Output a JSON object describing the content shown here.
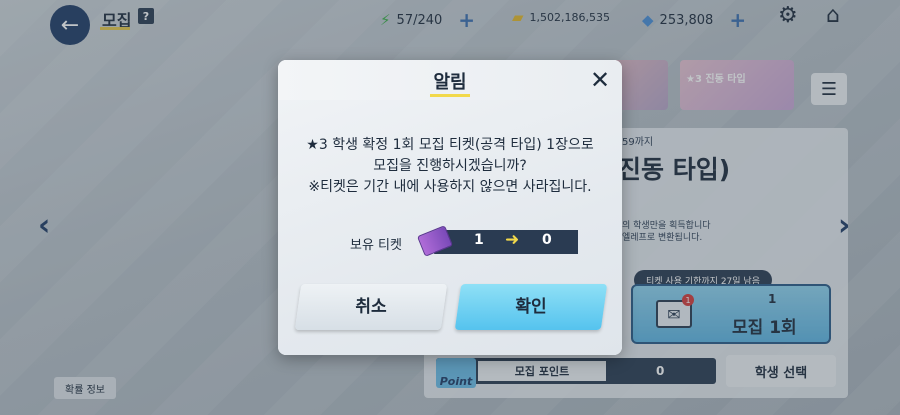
{
  "topbar": {
    "title": "모집",
    "help": "?",
    "ap": "57/240",
    "credits": "1,502,186,535",
    "gems": "253,808"
  },
  "background": {
    "banner_b_label": "★3 진동 타입",
    "panel_date": "59까지",
    "panel_title": "진동 타입)",
    "panel_desc1": "의 학생만을 획득합니다",
    "panel_desc2": "엘레프로 변환됩니다.",
    "ticket_expire": "티켓 사용 기한까지 27일 남음",
    "recruit_count": "1",
    "recruit_badge": "1",
    "recruit_label": "모집 1회",
    "point_icon": "Point",
    "point_label": "모집 포인트",
    "point_value": "0",
    "student_select": "학생 선택",
    "prob_info": "확률 정보"
  },
  "modal": {
    "title": "알림",
    "line1": "★3 학생 확정 1회 모집 티켓(공격 타입) 1장으로",
    "line2": "모집을 진행하시겠습니까?",
    "line3": "※티켓은 기간 내에 사용하지 않으면 사라집니다.",
    "own_label": "보유 티켓",
    "ticket_from": "1",
    "ticket_to": "0",
    "cancel": "취소",
    "confirm": "확인"
  },
  "colors": {
    "navy": "#1f3b66",
    "accent_yellow": "#f2d94b",
    "confirm_blue": "#55c3ee"
  }
}
